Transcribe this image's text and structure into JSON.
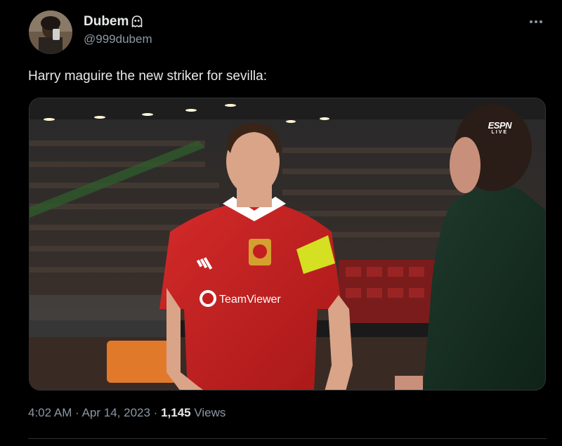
{
  "user": {
    "display_name": "Dubem",
    "handle": "@999dubem"
  },
  "tweet": {
    "text": "Harry maguire the new striker for sevilla:"
  },
  "media": {
    "broadcaster": "ESPN",
    "broadcast_tag": "LIVE",
    "shirt_sponsor": "TeamViewer"
  },
  "meta": {
    "time": "4:02 AM",
    "separator1": "·",
    "date": "Apr 14, 2023",
    "separator2": "·",
    "views_count": "1,145",
    "views_label": "Views"
  },
  "colors": {
    "background": "#000000",
    "primary_text": "#e7e9ea",
    "secondary_text": "#8b98a5",
    "border": "#2f3336",
    "shirt_red": "#c41e20",
    "armband_yellow": "#d4e021"
  },
  "icons": {
    "ghost": "ghost-icon",
    "more": "more-icon"
  }
}
